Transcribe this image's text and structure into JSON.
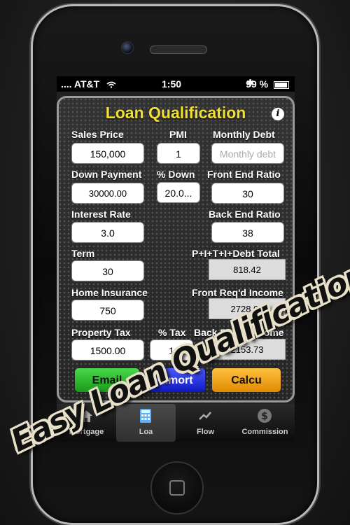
{
  "status": {
    "carrier": ".... AT&T",
    "time": "1:50",
    "battery": "99 %"
  },
  "app": {
    "title": "Loan Qualification"
  },
  "form": {
    "sales_price": {
      "label": "Sales Price",
      "value": "150,000"
    },
    "pmi": {
      "label": "PMI",
      "value": "1"
    },
    "monthly_debt": {
      "label": "Monthly Debt",
      "placeholder": "Monthly debt"
    },
    "down_payment": {
      "label": "Down Payment",
      "value": "30000.00"
    },
    "pct_down": {
      "label": "% Down",
      "value": "20.0..."
    },
    "front_end_ratio": {
      "label": "Front End Ratio",
      "value": "30"
    },
    "interest_rate": {
      "label": "Interest Rate",
      "value": "3.0"
    },
    "back_end_ratio": {
      "label": "Back End Ratio",
      "value": "38"
    },
    "term": {
      "label": "Term",
      "value": "30"
    },
    "pitid_total": {
      "label": "P+I+T+I+Debt Total",
      "value": "818.42"
    },
    "home_insurance": {
      "label": "Home Insurance",
      "value": "750"
    },
    "front_reqd_income": {
      "label": "Front Req'd Income",
      "value": "2728.06"
    },
    "property_tax": {
      "label": "Property Tax",
      "value": "1500.00"
    },
    "pct_tax": {
      "label": "% Tax",
      "value": "1"
    },
    "back_reqd_income": {
      "label": "Back Req'd Income",
      "value": "2153.73"
    }
  },
  "buttons": {
    "email": "Email",
    "amort": "Amort",
    "calc": "Calcu"
  },
  "tabs": [
    {
      "label": "Mortgage",
      "icon": "house-icon"
    },
    {
      "label": "Loa",
      "icon": "calculator-icon"
    },
    {
      "label": "Flow",
      "icon": "flow-icon"
    },
    {
      "label": "Commission",
      "icon": "dollar-icon"
    }
  ],
  "promo": "Easy Loan Qualifications!",
  "colors": {
    "title": "#f0e030",
    "email": "#1a9a1a",
    "amort": "#1018c0",
    "calc": "#e08a00"
  }
}
